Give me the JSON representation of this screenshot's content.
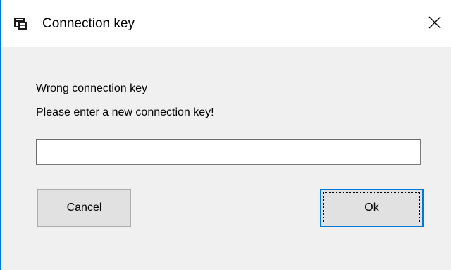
{
  "window": {
    "title": "Connection key",
    "icon": "window-app-icon",
    "close_icon": "close-icon",
    "accent_color": "#0078d7"
  },
  "dialog": {
    "message_line1": "Wrong connection key",
    "message_line2": "Please enter a new connection key!",
    "key_input": {
      "value": "",
      "placeholder": ""
    },
    "cancel_label": "Cancel",
    "ok_label": "Ok"
  }
}
